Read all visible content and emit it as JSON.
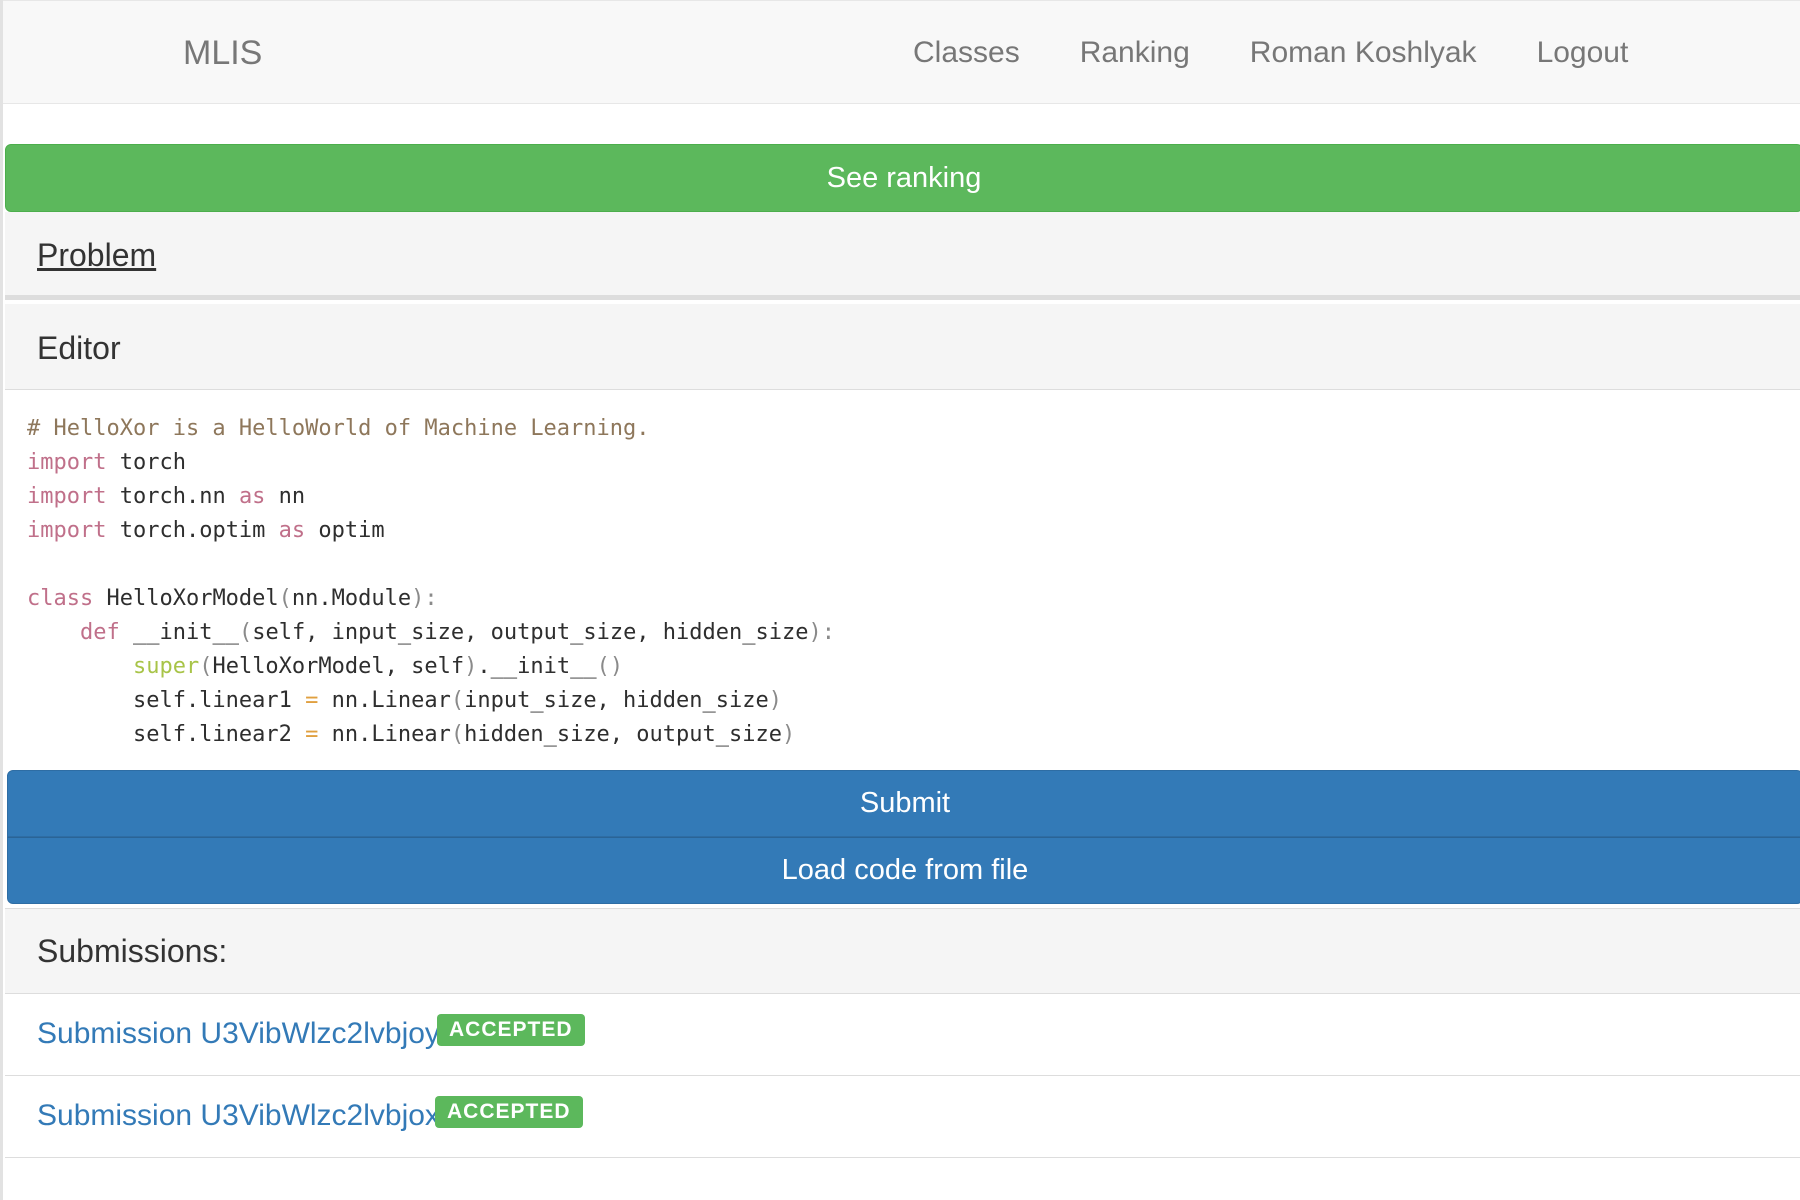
{
  "navbar": {
    "brand": "MLIS",
    "links": [
      "Classes",
      "Ranking",
      "Roman Koshlyak",
      "Logout"
    ]
  },
  "actions": {
    "see_ranking": "See ranking",
    "submit": "Submit",
    "load_code": "Load code from file"
  },
  "problem": {
    "title": "Problem"
  },
  "editor": {
    "title": "Editor",
    "code": [
      "# HelloXor is a HelloWorld of Machine Learning.",
      "import torch",
      "import torch.nn as nn",
      "import torch.optim as optim",
      "",
      "class HelloXorModel(nn.Module):",
      "    def __init__(self, input_size, output_size, hidden_size):",
      "        super(HelloXorModel, self).__init__()",
      "        self.linear1 = nn.Linear(input_size, hidden_size)",
      "        self.linear2 = nn.Linear(hidden_size, output_size)"
    ]
  },
  "submissions": {
    "title": "Submissions:",
    "items": [
      {
        "label": "Submission U3VibWlzc2lvbjoy",
        "status": "ACCEPTED"
      },
      {
        "label": "Submission U3VibWlzc2lvbjox",
        "status": "ACCEPTED"
      }
    ]
  },
  "colors": {
    "success": "#5cb85c",
    "primary": "#337ab7",
    "link": "#337ab7"
  }
}
